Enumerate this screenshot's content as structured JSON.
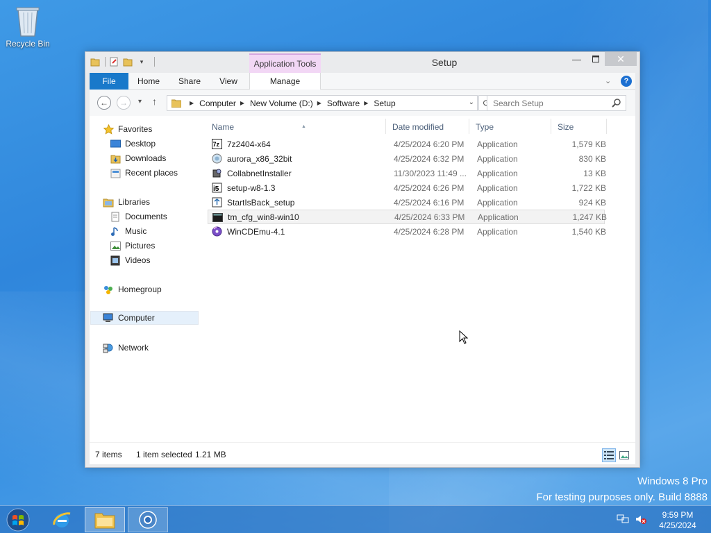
{
  "desktop": {
    "recycle_bin_label": "Recycle Bin"
  },
  "window": {
    "title": "Setup",
    "context_tab": "Application Tools",
    "ribbon_tabs": {
      "file": "File",
      "home": "Home",
      "share": "Share",
      "view": "View",
      "manage": "Manage"
    },
    "address": [
      "Computer",
      "New Volume (D:)",
      "Software",
      "Setup"
    ],
    "search_placeholder": "Search Setup"
  },
  "nav_pane": {
    "favorites": "Favorites",
    "desktop": "Desktop",
    "downloads": "Downloads",
    "recent_places": "Recent places",
    "libraries": "Libraries",
    "documents": "Documents",
    "music": "Music",
    "pictures": "Pictures",
    "videos": "Videos",
    "homegroup": "Homegroup",
    "computer": "Computer",
    "network": "Network"
  },
  "columns": {
    "name": "Name",
    "date": "Date modified",
    "type": "Type",
    "size": "Size"
  },
  "files": [
    {
      "name": "7z2404-x64",
      "date": "4/25/2024 6:20 PM",
      "type": "Application",
      "size": "1,579 KB",
      "icon": "7zip-icon"
    },
    {
      "name": "aurora_x86_32bit",
      "date": "4/25/2024 6:32 PM",
      "type": "Application",
      "size": "830 KB",
      "icon": "aurora-icon"
    },
    {
      "name": "CollabnetInstaller",
      "date": "11/30/2023 11:49 ...",
      "type": "Application",
      "size": "13 KB",
      "icon": "installer-icon"
    },
    {
      "name": "setup-w8-1.3",
      "date": "4/25/2024 6:26 PM",
      "type": "Application",
      "size": "1,722 KB",
      "icon": "setup-icon"
    },
    {
      "name": "StartIsBack_setup",
      "date": "4/25/2024 6:16 PM",
      "type": "Application",
      "size": "924 KB",
      "icon": "startisback-icon"
    },
    {
      "name": "tm_cfg_win8-win10",
      "date": "4/25/2024 6:33 PM",
      "type": "Application",
      "size": "1,247 KB",
      "icon": "console-icon"
    },
    {
      "name": "WinCDEmu-4.1",
      "date": "4/25/2024 6:28 PM",
      "type": "Application",
      "size": "1,540 KB",
      "icon": "wincdemu-icon"
    }
  ],
  "selected_file_index": 5,
  "status": {
    "item_count": "7 items",
    "selection": "1 item selected",
    "selection_size": "1.21 MB"
  },
  "watermark": {
    "line1": "Windows 8 Pro",
    "line2": "For testing purposes only. Build 8888"
  },
  "taskbar": {
    "time": "9:59 PM",
    "date": "4/25/2024"
  },
  "colors": {
    "accent": "#1979ca",
    "context_tab": "#f2d7f5"
  }
}
